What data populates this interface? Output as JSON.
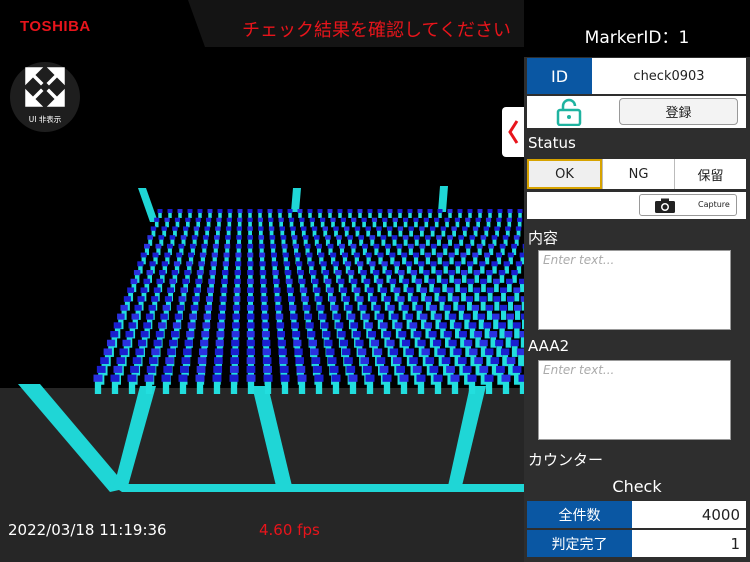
{
  "app": {
    "brand": "TOSHIBA",
    "alert_message": "チェック結果を確認してください",
    "ui_toggle_label": "UI 非表示",
    "timestamp": "2022/03/18 11:19:36",
    "fps": "4.60 fps"
  },
  "panel": {
    "marker_title": "MarkerID：1",
    "id_label": "ID",
    "id_value": "check0903",
    "register_label": "登録",
    "status_heading": "Status",
    "status_options": [
      "OK",
      "NG",
      "保留"
    ],
    "status_selected": "OK",
    "capture_label": "Capture",
    "content_heading": "内容",
    "content_placeholder": "Enter text...",
    "aaa2_heading": "AAA2",
    "aaa2_placeholder": "Enter text...",
    "counter_heading": "カウンター",
    "counter_subtitle": "Check",
    "counters": [
      {
        "label": "全件数",
        "value": "4000"
      },
      {
        "label": "判定完了",
        "value": "1"
      }
    ]
  },
  "colors": {
    "brand_red": "#e8141b",
    "accent_blue": "#0a57a3",
    "selected_outline": "#d7a300",
    "frame_cyan": "#1fd6d6",
    "cube_blue": "#1a1fd0",
    "cube_cyan": "#22dede"
  },
  "icons": {
    "ui_toggle": "expand-arrows-icon",
    "collapse_tab": "chevron-left-icon",
    "lock": "unlock-icon",
    "capture": "camera-icon"
  }
}
